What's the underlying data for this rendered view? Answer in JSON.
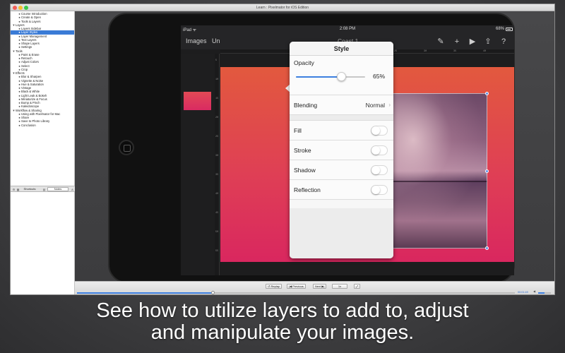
{
  "window": {
    "title": "Learn : Pixelmator for iOS Edition"
  },
  "sidebar": {
    "items": [
      {
        "label": "Course Introduction",
        "level": 1,
        "mark": "●"
      },
      {
        "label": "Create & Open",
        "level": 1,
        "mark": "●"
      },
      {
        "label": "Tools & Layers",
        "level": 1,
        "mark": "●"
      },
      {
        "label": "Layers",
        "level": 0,
        "mark": "▼"
      },
      {
        "label": "Layers Sidebar",
        "level": 1,
        "mark": "●"
      },
      {
        "label": "Layer Styles",
        "level": 1,
        "mark": "●",
        "selected": true
      },
      {
        "label": "Layer Management",
        "level": 1,
        "mark": "●"
      },
      {
        "label": "Text Layers",
        "level": 1,
        "mark": "●"
      },
      {
        "label": "Shape Layers",
        "level": 1,
        "mark": "●"
      },
      {
        "label": "Settings",
        "level": 1,
        "mark": "●"
      },
      {
        "label": "Tools",
        "level": 0,
        "mark": "▼"
      },
      {
        "label": "Paint & Erase",
        "level": 1,
        "mark": "●"
      },
      {
        "label": "Retouch",
        "level": 1,
        "mark": "●"
      },
      {
        "label": "Adjust Colors",
        "level": 1,
        "mark": "●"
      },
      {
        "label": "Select",
        "level": 1,
        "mark": "●"
      },
      {
        "label": "Crop",
        "level": 1,
        "mark": "●"
      },
      {
        "label": "Effects",
        "level": 0,
        "mark": "▼"
      },
      {
        "label": "Blur & Sharpen",
        "level": 1,
        "mark": "●"
      },
      {
        "label": "Vignette & Noise",
        "level": 1,
        "mark": "●"
      },
      {
        "label": "Hue & Saturation",
        "level": 1,
        "mark": "●"
      },
      {
        "label": "Vintage",
        "level": 1,
        "mark": "●"
      },
      {
        "label": "Black & White",
        "level": 1,
        "mark": "●"
      },
      {
        "label": "Light Leak & Bokeh",
        "level": 1,
        "mark": "●"
      },
      {
        "label": "Miniaturize & Focus",
        "level": 1,
        "mark": "●"
      },
      {
        "label": "Bump & Pinch",
        "level": 1,
        "mark": "●"
      },
      {
        "label": "Kaleidoscope",
        "level": 1,
        "mark": "●"
      },
      {
        "label": "Workflow & Sharing",
        "level": 0,
        "mark": "▼"
      },
      {
        "label": "Using with Pixelmator for Mac",
        "level": 1,
        "mark": "●"
      },
      {
        "label": "Share",
        "level": 1,
        "mark": "●"
      },
      {
        "label": "Save to Photo Library",
        "level": 1,
        "mark": "●"
      },
      {
        "label": "Conclusion",
        "level": 1,
        "mark": "●"
      }
    ],
    "tabs": {
      "shortcuts": "Shortcuts",
      "notes": "Notes"
    }
  },
  "ipad": {
    "status": {
      "device": "iPad ᯤ",
      "time": "2:08 PM",
      "battery": "68%"
    },
    "toolbar": {
      "images": "Images",
      "undo": "Un",
      "title": "Coast 1"
    },
    "ruler_h": [
      "10",
      "15",
      "20",
      "25",
      "30",
      "35",
      "40"
    ],
    "ruler_v": [
      "5",
      "10",
      "15",
      "20",
      "25",
      "30",
      "35",
      "40",
      "45",
      "50",
      "55"
    ]
  },
  "style_panel": {
    "title": "Style",
    "opacity_label": "Opacity",
    "opacity_value": "65%",
    "opacity_fraction": 0.65,
    "blending_label": "Blending",
    "blending_value": "Normal",
    "fill_label": "Fill",
    "stroke_label": "Stroke",
    "shadow_label": "Shadow",
    "reflection_label": "Reflection"
  },
  "controls": {
    "replay": "↺ Replay",
    "previous": "|◀ Previous",
    "next": "Next ▶|",
    "speed": "1x",
    "time": "00:01:49",
    "progress_fraction": 0.31,
    "volume_fraction": 0.5
  },
  "caption": {
    "line1": "See how to utilize layers to add to, adjust",
    "line2": "and manipulate your images."
  }
}
